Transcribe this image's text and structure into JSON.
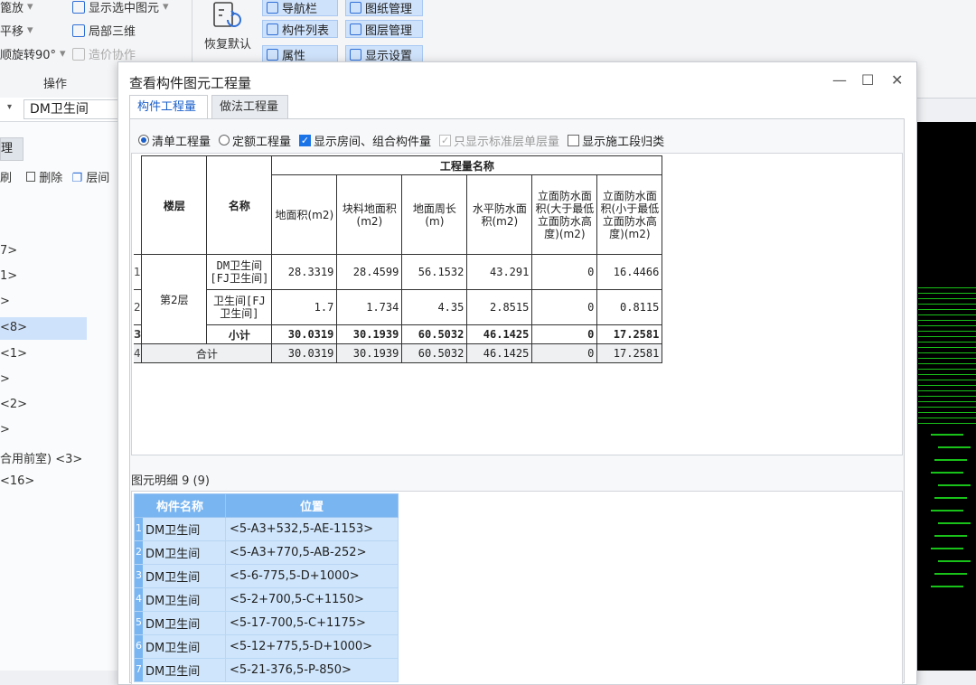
{
  "ribbon": {
    "left_items": [
      "篦放",
      "平移",
      "顺旋转90°"
    ],
    "mid_items": [
      "显示选中图元",
      "局部三维",
      "造价协作"
    ],
    "group_label": "操作",
    "restore_label": "恢复默认",
    "blue_buttons": [
      "导航栏",
      "构件列表",
      "属性",
      "图纸管理",
      "图层管理",
      "显示设置"
    ]
  },
  "left_panel": {
    "dropdown_value": "DM卫生间",
    "tab_label": "理",
    "toolbar": [
      "刷",
      "删除",
      "层间"
    ],
    "tree_items": [
      "7>",
      "1>",
      ">",
      "<8>",
      "<1>",
      ">",
      "<2>",
      ">",
      "合用前室) <3>",
      "<16>"
    ]
  },
  "dialog": {
    "title": "查看构件图元工程量",
    "controls": {
      "minimize": "—",
      "maximize": "☐",
      "close": "✕"
    },
    "tabs": [
      "构件工程量",
      "做法工程量"
    ],
    "options": [
      {
        "label": "清单工程量",
        "kind": "radio",
        "checked": true
      },
      {
        "label": "定额工程量",
        "kind": "radio",
        "checked": false
      },
      {
        "label": "显示房间、组合构件量",
        "kind": "checkbox",
        "checked": true
      },
      {
        "label": "只显示标准层单层量",
        "kind": "checkbox",
        "checked": true,
        "disabled": true
      },
      {
        "label": "显示施工段归类",
        "kind": "checkbox",
        "checked": false
      }
    ],
    "qty_table": {
      "group_header": "工程量名称",
      "col_floor": "楼层",
      "col_name": "名称",
      "columns": [
        "地面积(m2)",
        "块料地面积(m2)",
        "地面周长(m)",
        "水平防水面积(m2)",
        "立面防水面积(大于最低立面防水高度)(m2)",
        "立面防水面积(小于最低立面防水高度)(m2)"
      ],
      "floor": "第2层",
      "rows": [
        {
          "idx": "1",
          "name": "DM卫生间[FJ卫生间]",
          "values": [
            "28.3319",
            "28.4599",
            "56.1532",
            "43.291",
            "0",
            "16.4466"
          ]
        },
        {
          "idx": "2",
          "name": "卫生间[FJ卫生间]",
          "values": [
            "1.7",
            "1.734",
            "4.35",
            "2.8515",
            "0",
            "0.8115"
          ]
        }
      ],
      "subtotal": {
        "idx": "3",
        "label": "小计",
        "values": [
          "30.0319",
          "30.1939",
          "60.5032",
          "46.1425",
          "0",
          "17.2581"
        ]
      },
      "total": {
        "idx": "4",
        "label": "合计",
        "values": [
          "30.0319",
          "30.1939",
          "60.5032",
          "46.1425",
          "0",
          "17.2581"
        ]
      }
    },
    "detail_title": "图元明细  9 (9)",
    "detail_table": {
      "headers": [
        "构件名称",
        "位置"
      ],
      "rows": [
        {
          "idx": "1",
          "name": "DM卫生间",
          "pos": "<5-A3+532,5-AE-1153>"
        },
        {
          "idx": "2",
          "name": "DM卫生间",
          "pos": "<5-A3+770,5-AB-252>"
        },
        {
          "idx": "3",
          "name": "DM卫生间",
          "pos": "<5-6-775,5-D+1000>"
        },
        {
          "idx": "4",
          "name": "DM卫生间",
          "pos": "<5-2+700,5-C+1150>"
        },
        {
          "idx": "5",
          "name": "DM卫生间",
          "pos": "<5-17-700,5-C+1175>"
        },
        {
          "idx": "6",
          "name": "DM卫生间",
          "pos": "<5-12+775,5-D+1000>"
        },
        {
          "idx": "7",
          "name": "DM卫生间",
          "pos": "<5-21-376,5-P-850>"
        }
      ]
    }
  },
  "colors": {
    "accent": "#1b5fc9",
    "header_blue": "#79b5f0",
    "row_blue": "#cfe5fb",
    "cad_bg": "#000000",
    "cad_line": "#19c219"
  }
}
